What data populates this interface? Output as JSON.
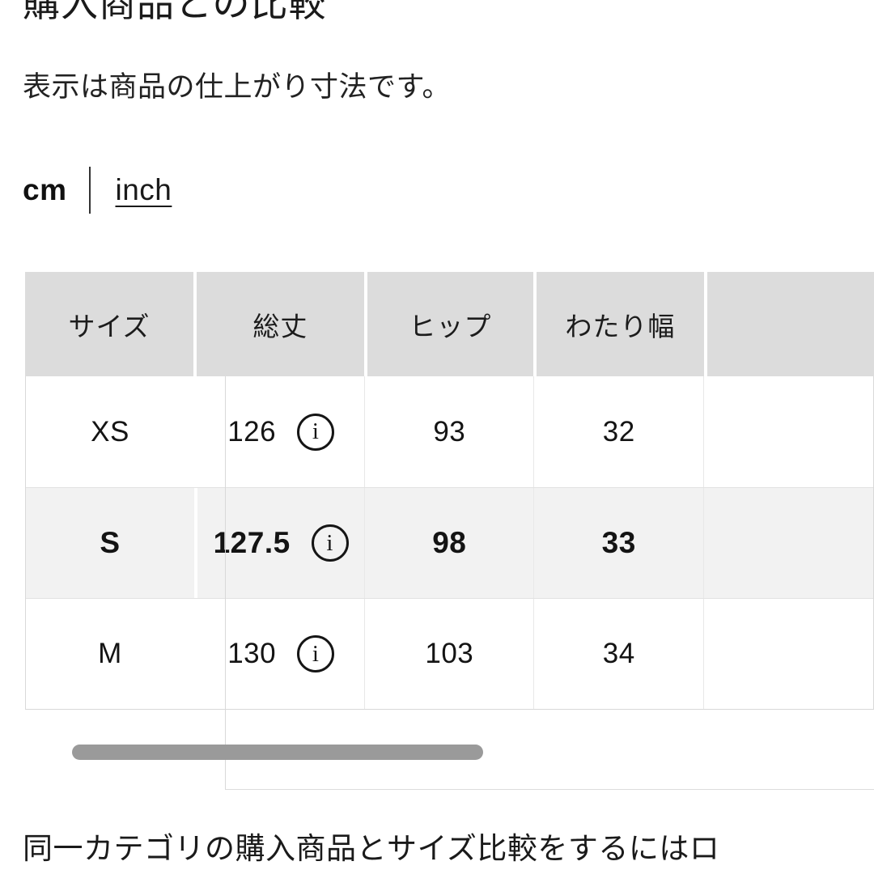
{
  "heading": "購入商品との比較",
  "subtitle": "表示は商品の仕上がり寸法です。",
  "unit_toggle": {
    "cm_label": "cm",
    "inch_label": "inch",
    "selected": "cm"
  },
  "table": {
    "headers": [
      "サイズ",
      "総丈",
      "ヒップ",
      "わたり幅",
      ""
    ],
    "rows": [
      {
        "size": "XS",
        "total_length": "126",
        "hip": "93",
        "thigh_width": "32",
        "extra": "",
        "info_icon": "info-icon",
        "highlighted": false
      },
      {
        "size": "S",
        "total_length": "127.5",
        "hip": "98",
        "thigh_width": "33",
        "extra": "",
        "info_icon": "info-icon",
        "highlighted": true
      },
      {
        "size": "M",
        "total_length": "130",
        "hip": "103",
        "thigh_width": "34",
        "extra": "",
        "info_icon": "info-icon",
        "highlighted": false
      }
    ],
    "info_glyph": "i"
  },
  "scrollbar": {
    "orientation": "horizontal",
    "thumb_position_percent": 7,
    "thumb_width_percent": 63
  },
  "footer_text": "同一カテゴリの購入商品とサイズ比較をするにはロ",
  "colors": {
    "page_background": "#ffffff",
    "header_background": "#dcdcdc",
    "highlight_row_background": "#f2f2f2",
    "border": "#d9d9d9",
    "text": "#141414",
    "scrollbar_thumb": "#9a9a9a"
  }
}
